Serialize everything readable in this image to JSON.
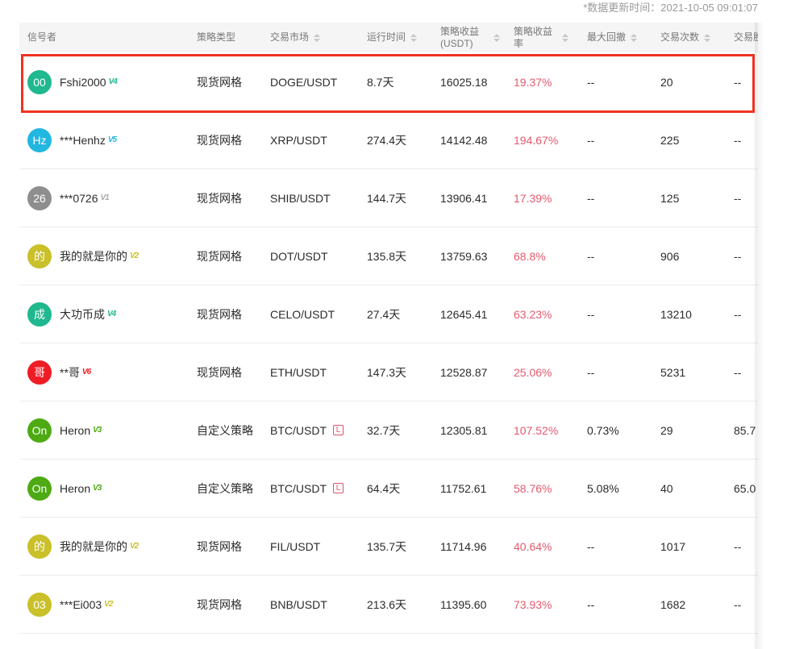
{
  "update_time": "*数据更新时间：2021-10-05 09:01:07",
  "headers": {
    "signaler": "信号者",
    "strategy_type": "策略类型",
    "market": "交易市场",
    "runtime": "运行时间",
    "profit_l1": "策略收益",
    "profit_l2": "(USDT)",
    "rate_l1": "策略收益",
    "rate_l2": "率",
    "drawdown": "最大回撤",
    "trades": "交易次数",
    "extra": "交易胜"
  },
  "colors": {
    "return": "#e25a6e",
    "highlight": "#f03222"
  },
  "rows": [
    {
      "avatar": "00",
      "avatar_color": "#1fb88f",
      "name": "Fshi2000",
      "badge": "V4",
      "badge_color": "#1fb88f",
      "type": "现货网格",
      "market": "DOGE/USDT",
      "leverage": "",
      "runtime": "8.7天",
      "profit": "16025.18",
      "rate": "19.37%",
      "drawdown": "--",
      "trades": "20",
      "extra": "--"
    },
    {
      "avatar": "Hz",
      "avatar_color": "#22b7df",
      "name": "***Henhz",
      "badge": "V5",
      "badge_color": "#22b7df",
      "type": "现货网格",
      "market": "XRP/USDT",
      "leverage": "",
      "runtime": "274.4天",
      "profit": "14142.48",
      "rate": "194.67%",
      "drawdown": "--",
      "trades": "225",
      "extra": "--"
    },
    {
      "avatar": "26",
      "avatar_color": "#8e8e8e",
      "name": "***0726",
      "badge": "V1",
      "badge_color": "#a9a9a9",
      "type": "现货网格",
      "market": "SHIB/USDT",
      "leverage": "",
      "runtime": "144.7天",
      "profit": "13906.41",
      "rate": "17.39%",
      "drawdown": "--",
      "trades": "125",
      "extra": "--"
    },
    {
      "avatar": "的",
      "avatar_color": "#c9c02a",
      "name": "我的就是你的",
      "badge": "V2",
      "badge_color": "#c9c02a",
      "type": "现货网格",
      "market": "DOT/USDT",
      "leverage": "",
      "runtime": "135.8天",
      "profit": "13759.63",
      "rate": "68.8%",
      "drawdown": "--",
      "trades": "906",
      "extra": "--"
    },
    {
      "avatar": "成",
      "avatar_color": "#1fb88f",
      "name": "大功币成",
      "badge": "V4",
      "badge_color": "#1fb88f",
      "type": "现货网格",
      "market": "CELO/USDT",
      "leverage": "",
      "runtime": "27.4天",
      "profit": "12645.41",
      "rate": "63.23%",
      "drawdown": "--",
      "trades": "13210",
      "extra": "--"
    },
    {
      "avatar": "哥",
      "avatar_color": "#ee1c25",
      "name": "**哥",
      "badge": "V6",
      "badge_color": "#ee1c25",
      "type": "现货网格",
      "market": "ETH/USDT",
      "leverage": "",
      "runtime": "147.3天",
      "profit": "12528.87",
      "rate": "25.06%",
      "drawdown": "--",
      "trades": "5231",
      "extra": "--"
    },
    {
      "avatar": "On",
      "avatar_color": "#4daa13",
      "name": "Heron",
      "badge": "V3",
      "badge_color": "#4daa13",
      "type": "自定义策略",
      "market": "BTC/USDT",
      "leverage": "L",
      "runtime": "32.7天",
      "profit": "12305.81",
      "rate": "107.52%",
      "drawdown": "0.73%",
      "trades": "29",
      "extra": "85.7"
    },
    {
      "avatar": "On",
      "avatar_color": "#4daa13",
      "name": "Heron",
      "badge": "V3",
      "badge_color": "#4daa13",
      "type": "自定义策略",
      "market": "BTC/USDT",
      "leverage": "L",
      "runtime": "64.4天",
      "profit": "11752.61",
      "rate": "58.76%",
      "drawdown": "5.08%",
      "trades": "40",
      "extra": "65.0"
    },
    {
      "avatar": "的",
      "avatar_color": "#c9c02a",
      "name": "我的就是你的",
      "badge": "V2",
      "badge_color": "#c9c02a",
      "type": "现货网格",
      "market": "FIL/USDT",
      "leverage": "",
      "runtime": "135.7天",
      "profit": "11714.96",
      "rate": "40.64%",
      "drawdown": "--",
      "trades": "1017",
      "extra": "--"
    },
    {
      "avatar": "03",
      "avatar_color": "#c9c02a",
      "name": "***Ei003",
      "badge": "V2",
      "badge_color": "#c9c02a",
      "type": "现货网格",
      "market": "BNB/USDT",
      "leverage": "",
      "runtime": "213.6天",
      "profit": "11395.60",
      "rate": "73.93%",
      "drawdown": "--",
      "trades": "1682",
      "extra": "--"
    }
  ]
}
